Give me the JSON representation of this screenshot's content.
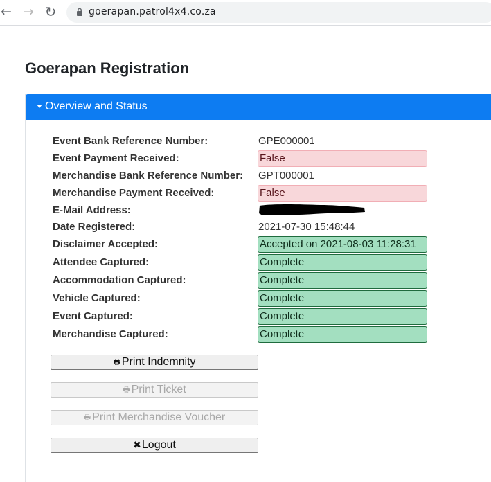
{
  "browser": {
    "back_icon": "arrow-left-icon",
    "forward_icon": "arrow-right-icon",
    "reload_icon": "reload-icon",
    "back_glyph": "←",
    "forward_glyph": "→",
    "reload_glyph": "↻",
    "url": "goerapan.patrol4x4.co.za"
  },
  "page": {
    "title": "Goerapan Registration"
  },
  "panel": {
    "header_label": "Overview and Status",
    "header_color": "#0d7cf2",
    "rows": [
      {
        "label": "Event Bank Reference Number:",
        "value": "GPE000001",
        "style": "plain"
      },
      {
        "label": "Event Payment Received:",
        "value": "False",
        "style": "false"
      },
      {
        "label": "Merchandise Bank Reference Number:",
        "value": "GPT000001",
        "style": "plain"
      },
      {
        "label": "Merchandise Payment Received:",
        "value": "False",
        "style": "false"
      },
      {
        "label": "E-Mail Address:",
        "value": "",
        "style": "redacted"
      },
      {
        "label": "Date Registered:",
        "value": "2021-07-30 15:48:44",
        "style": "plain"
      },
      {
        "label": "Disclaimer Accepted:",
        "value": "Accepted on 2021-08-03 11:28:31",
        "style": "ok"
      },
      {
        "label": "Attendee Captured:",
        "value": "Complete",
        "style": "ok"
      },
      {
        "label": "Accommodation Captured:",
        "value": "Complete",
        "style": "ok"
      },
      {
        "label": "Vehicle Captured:",
        "value": "Complete",
        "style": "ok"
      },
      {
        "label": "Event Captured:",
        "value": "Complete",
        "style": "ok"
      },
      {
        "label": "Merchandise Captured:",
        "value": "Complete",
        "style": "ok"
      }
    ]
  },
  "actions": {
    "print_indemnity": {
      "label": "Print Indemnity",
      "icon": "printer-icon",
      "glyph": "🖶",
      "enabled": true
    },
    "print_ticket": {
      "label": "Print Ticket",
      "icon": "printer-icon",
      "glyph": "🖶",
      "enabled": false
    },
    "print_voucher": {
      "label": "Print Merchandise Voucher",
      "icon": "printer-icon",
      "glyph": "🖶",
      "enabled": false
    },
    "logout": {
      "label": "Logout",
      "icon": "close-icon",
      "glyph": "✖",
      "enabled": true
    }
  },
  "colors": {
    "false_badge": "#f8d7da",
    "ok_badge": "#a3dfc0"
  }
}
